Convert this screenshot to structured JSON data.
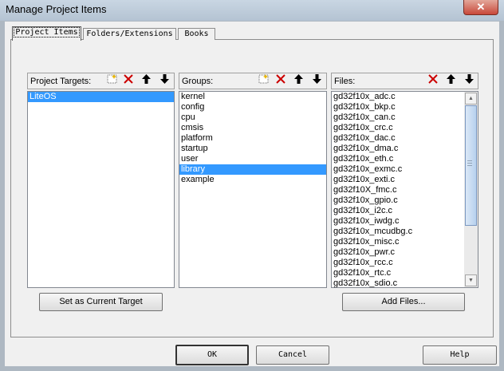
{
  "window": {
    "title": "Manage Project Items",
    "close_glyph": "✕"
  },
  "tabs": [
    {
      "label": "Project Items",
      "active": true
    },
    {
      "label": "Folders/Extensions",
      "active": false
    },
    {
      "label": "Books",
      "active": false
    }
  ],
  "panes": {
    "targets": {
      "label": "Project Targets:",
      "items": [
        "LiteOS"
      ],
      "selected": 0,
      "tools": {
        "new": "new-icon",
        "delete": "delete-icon",
        "move_up": "arrow-up-icon",
        "move_down": "arrow-down-icon"
      }
    },
    "groups": {
      "label": "Groups:",
      "items": [
        "kernel",
        "config",
        "cpu",
        "cmsis",
        "platform",
        "startup",
        "user",
        "library",
        "example"
      ],
      "selected": 7,
      "tools": {
        "new": "new-icon",
        "delete": "delete-icon",
        "move_up": "arrow-up-icon",
        "move_down": "arrow-down-icon"
      }
    },
    "files": {
      "label": "Files:",
      "items": [
        "gd32f10x_adc.c",
        "gd32f10x_bkp.c",
        "gd32f10x_can.c",
        "gd32f10x_crc.c",
        "gd32f10x_dac.c",
        "gd32f10x_dma.c",
        "gd32f10x_eth.c",
        "gd32f10x_exmc.c",
        "gd32f10x_exti.c",
        "gd32f10X_fmc.c",
        "gd32f10x_gpio.c",
        "gd32f10x_i2c.c",
        "gd32f10x_iwdg.c",
        "gd32f10x_mcudbg.c",
        "gd32f10x_misc.c",
        "gd32f10x_pwr.c",
        "gd32f10x_rcc.c",
        "gd32f10x_rtc.c",
        "gd32f10x_sdio.c"
      ],
      "tools": {
        "delete": "delete-icon",
        "move_up": "arrow-up-icon",
        "move_down": "arrow-down-icon"
      }
    }
  },
  "buttons": {
    "set_current_target": "Set as Current Target",
    "add_files": "Add Files...",
    "ok": "OK",
    "cancel": "Cancel",
    "help": "Help"
  },
  "colors": {
    "selection": "#3399ff",
    "delete_icon": "#cc0000",
    "dialog_bg": "#f0f0f0"
  }
}
